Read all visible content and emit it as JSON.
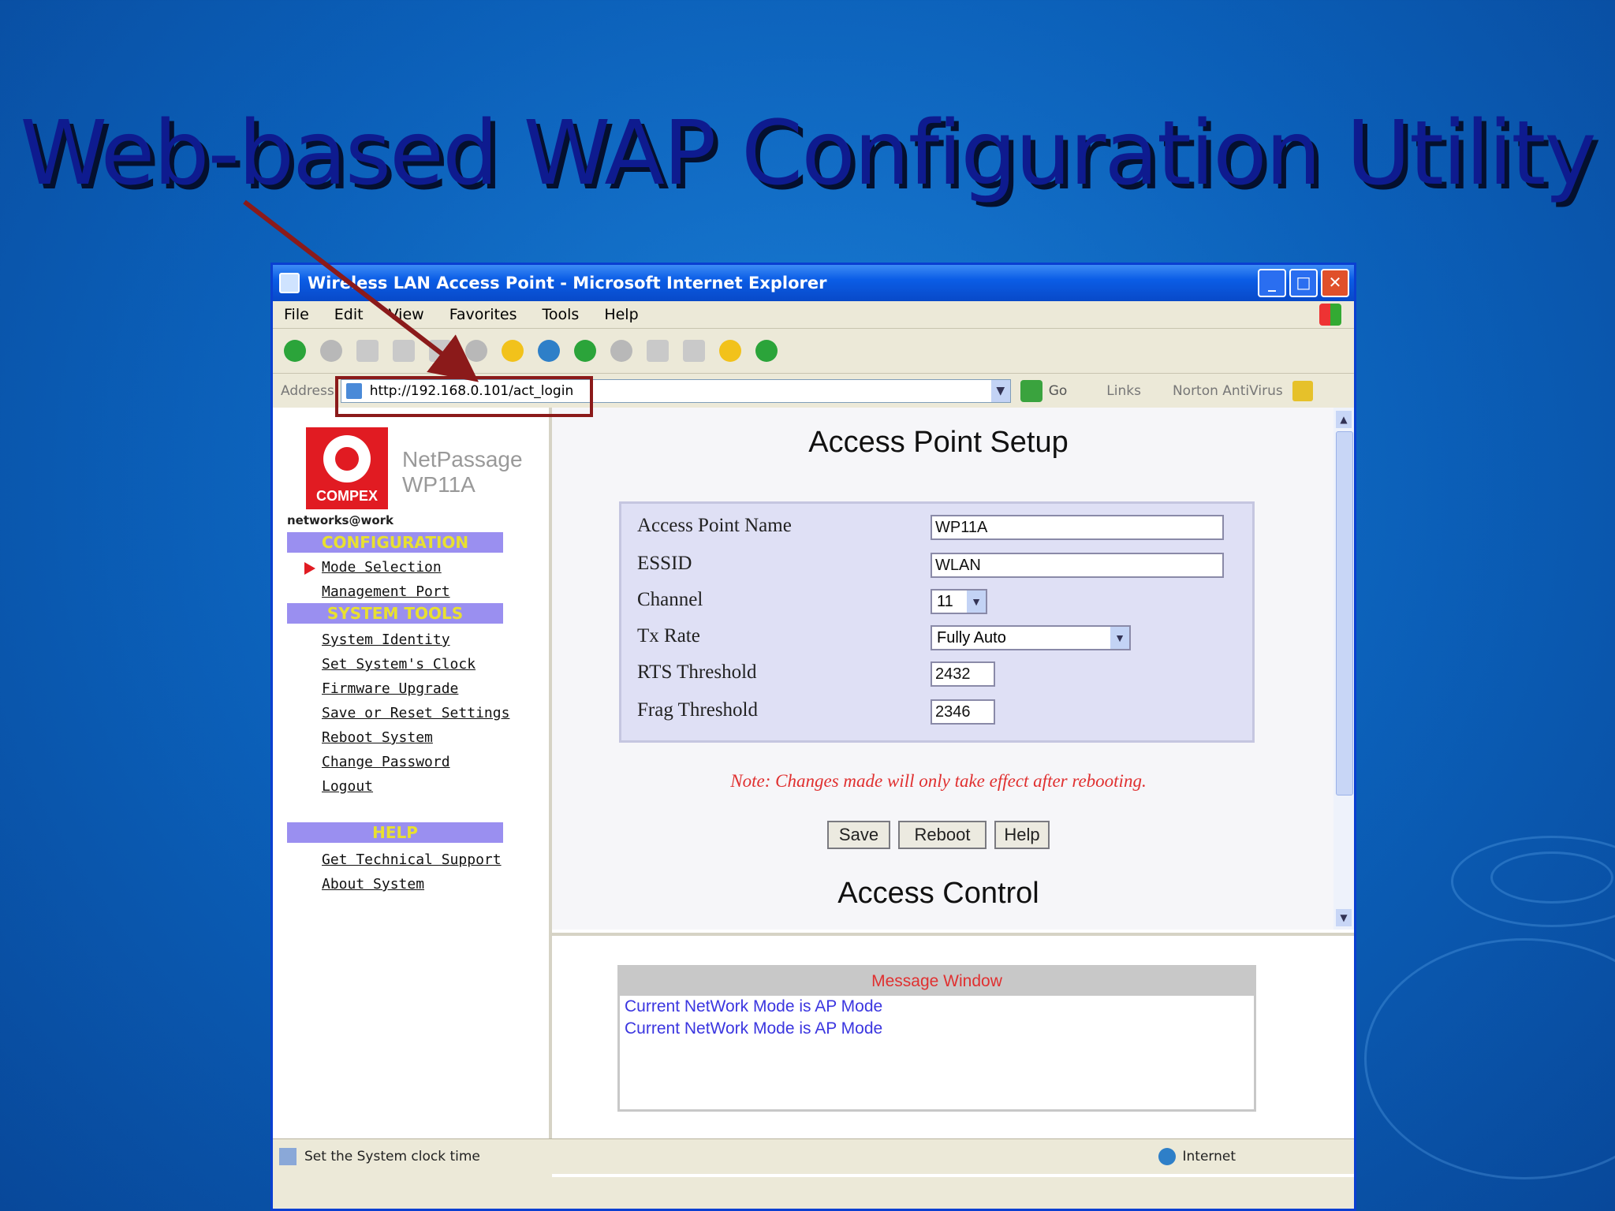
{
  "slide": {
    "title": "Web-based WAP Configuration Utility"
  },
  "browser": {
    "window_title": "Wireless LAN Access Point - Microsoft Internet Explorer",
    "menu": [
      "File",
      "Edit",
      "View",
      "Favorites",
      "Tools",
      "Help"
    ],
    "address_label": "Address",
    "url": "http://192.168.0.101/act_login",
    "go_label": "Go",
    "links_label": "Links",
    "norton_label": "Norton AntiVirus",
    "status_text": "Set the System clock time",
    "zone_text": "Internet"
  },
  "sidebar": {
    "logo_text": "COMPEX",
    "product_line1": "NetPassage",
    "product_line2": "WP11A",
    "tagline": "networks@work",
    "configuration_header": "CONFIGURATION",
    "configuration_items": [
      "Mode Selection",
      "Management Port"
    ],
    "system_tools_header": "SYSTEM TOOLS",
    "system_tools_items": [
      "System Identity",
      "Set System's Clock",
      "Firmware Upgrade",
      "Save or Reset Settings",
      "Reboot System",
      "Change Password",
      "Logout"
    ],
    "help_header": "HELP",
    "help_items": [
      "Get Technical Support",
      "About System"
    ]
  },
  "main": {
    "title": "Access Point Setup",
    "fields": {
      "ap_name_label": "Access Point Name",
      "ap_name_value": "WP11A",
      "essid_label": "ESSID",
      "essid_value": "WLAN",
      "channel_label": "Channel",
      "channel_value": "11",
      "txrate_label": "Tx Rate",
      "txrate_value": "Fully Auto",
      "rts_label": "RTS Threshold",
      "rts_value": "2432",
      "frag_label": "Frag Threshold",
      "frag_value": "2346"
    },
    "note": "Note: Changes made will only take effect after rebooting.",
    "buttons": {
      "save": "Save",
      "reboot": "Reboot",
      "help": "Help"
    },
    "section2_title": "Access Control"
  },
  "message_window": {
    "title": "Message Window",
    "lines": [
      "Current NetWork Mode is AP Mode",
      "Current NetWork Mode is AP Mode"
    ]
  },
  "colors": {
    "background": "#0b5fb8",
    "title_text": "#0e1b8f",
    "highlight": "#8b1a1a",
    "sidebar_header": "#9a8ff0",
    "note_text": "#e03030"
  }
}
